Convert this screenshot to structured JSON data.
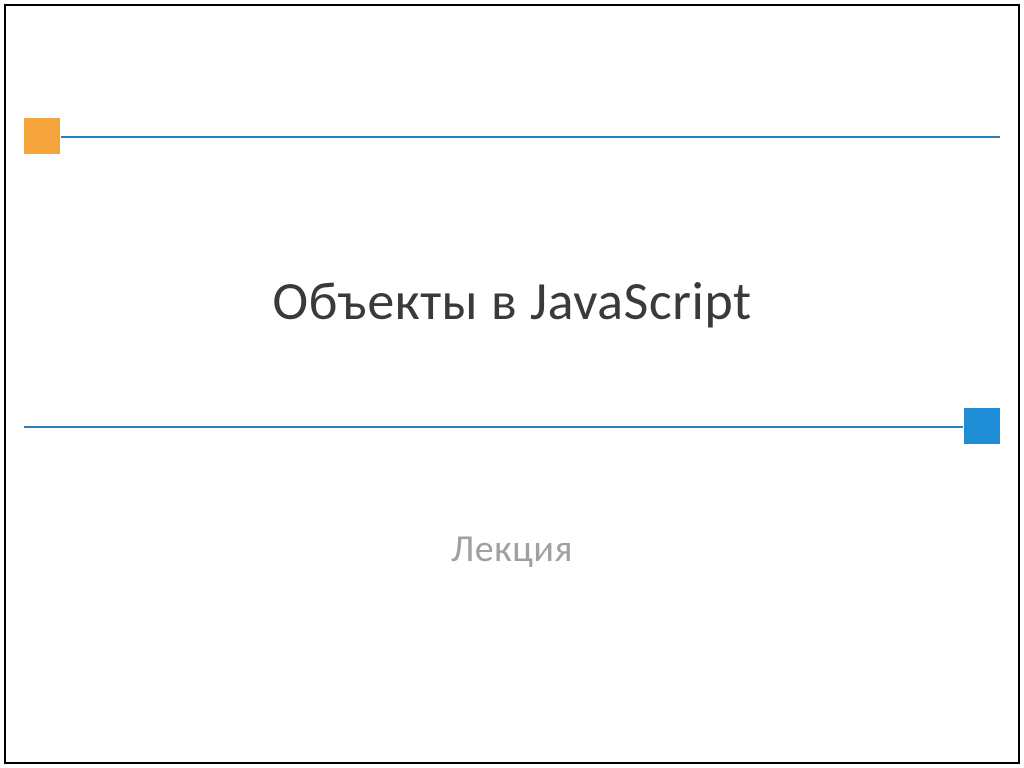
{
  "slide": {
    "title": "Объекты в JavaScript",
    "subtitle": "Лекция"
  },
  "colors": {
    "accent_orange": "#f5a33b",
    "accent_blue": "#1f8dd6",
    "rule_blue": "#2a7fba",
    "text_dark": "#3a3a3a",
    "text_muted": "#a0a0a0"
  }
}
